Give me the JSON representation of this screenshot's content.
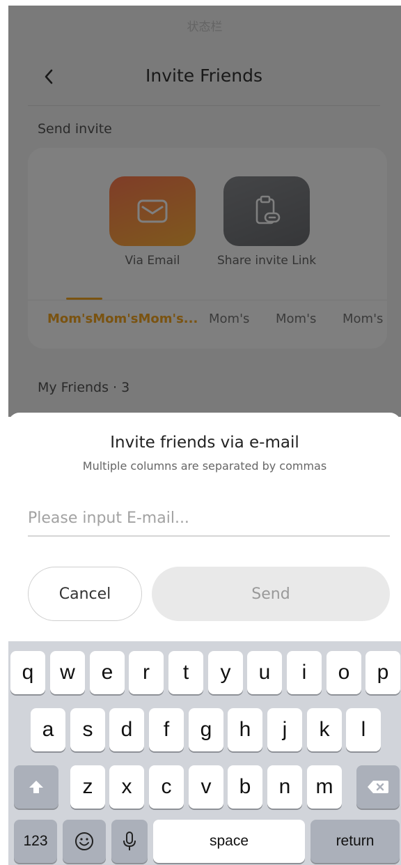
{
  "status_bar": {
    "text": "状态栏"
  },
  "nav": {
    "title": "Invite Friends",
    "back_icon": "chevron-left-icon"
  },
  "send_invite": {
    "label": "Send invite",
    "options": [
      {
        "label": "Via Email",
        "icon": "mail-icon"
      },
      {
        "label": "Share invite Link",
        "icon": "clipboard-link-icon"
      }
    ],
    "tabs": [
      "Mom'sMom'sMom's...",
      "Mom's",
      "Mom's",
      "Mom's"
    ],
    "active_tab": 0
  },
  "friends": {
    "label": "My Friends · 3"
  },
  "sheet": {
    "title": "Invite friends via e-mail",
    "subtitle": "Multiple columns are separated by commas",
    "email_placeholder": "Please input E-mail...",
    "email_value": "",
    "cancel_label": "Cancel",
    "send_label": "Send"
  },
  "keyboard": {
    "row1": [
      "q",
      "w",
      "e",
      "r",
      "t",
      "y",
      "u",
      "i",
      "o",
      "p"
    ],
    "row2": [
      "a",
      "s",
      "d",
      "f",
      "g",
      "h",
      "j",
      "k",
      "l"
    ],
    "row3": [
      "z",
      "x",
      "c",
      "v",
      "b",
      "n",
      "m"
    ],
    "numbers_label": "123",
    "space_label": "space",
    "return_label": "return"
  },
  "colors": {
    "accent": "#f4a623",
    "email_tile": "#ff8c42",
    "link_tile": "#7a7c80"
  }
}
